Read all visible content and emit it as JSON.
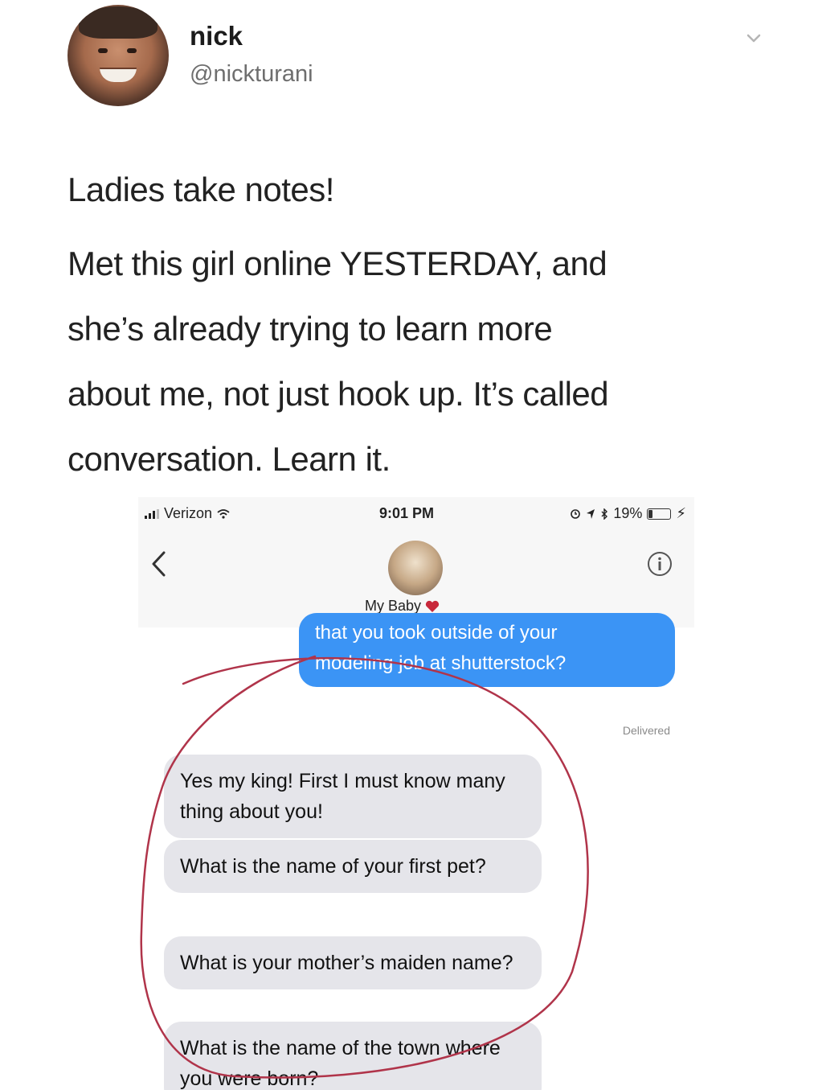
{
  "tweet": {
    "author_name": "nick",
    "author_handle": "@nickturani",
    "text_lines": [
      "Ladies take notes!",
      "Met this girl online YESTERDAY, and",
      "she’s already trying to learn more",
      "about me, not just hook up. It’s called",
      "conversation. Learn it."
    ],
    "menu_icon": "chevron-down-icon"
  },
  "phone": {
    "carrier": "Verizon",
    "time": "9:01 PM",
    "battery_percent": "19%",
    "battery_level": 0.19,
    "contact_name": "My Baby",
    "messages_out": [
      {
        "text_lines": [
          "that you took outside of your",
          "modeling job at shutterstock?"
        ]
      }
    ],
    "delivered_label": "Delivered",
    "messages_in": [
      {
        "text": "Yes my king! First I must know many thing about you!"
      },
      {
        "text": "What is the name of your first pet?"
      },
      {
        "text": "What is your mother’s maiden name?"
      },
      {
        "text": "What is the name of the town where you were born?"
      }
    ],
    "colors": {
      "outgoing_bubble": "#3b94f5",
      "incoming_bubble": "#e5e5ea",
      "annotation_circle": "#b0344a"
    }
  }
}
